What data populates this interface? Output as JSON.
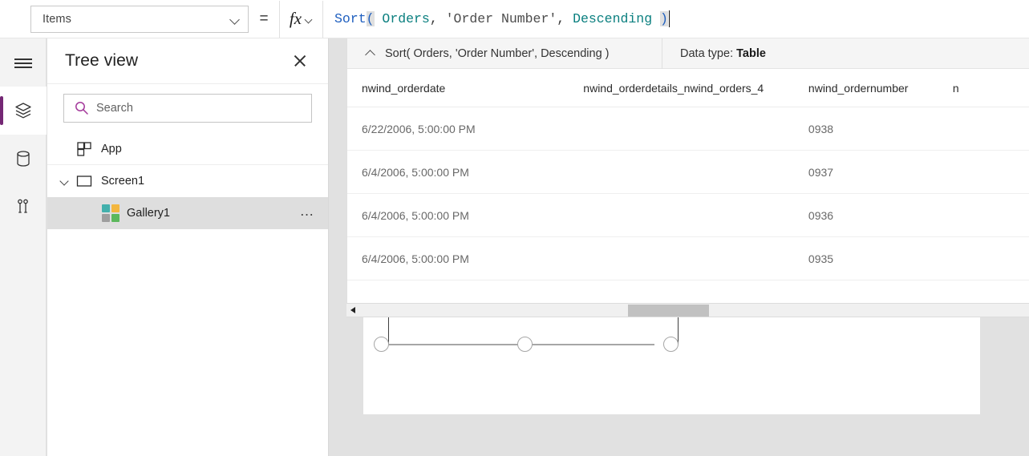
{
  "formula_bar": {
    "property_dropdown": {
      "value": "Items",
      "chevron_icon": "chevron-down-icon"
    },
    "equals_sign": "=",
    "fx_button": {
      "glyph": "fx",
      "chevron_icon": "chevron-down-icon"
    },
    "formula_tokens": [
      {
        "text": "Sort",
        "type": "function"
      },
      {
        "text": "(",
        "type": "paren-highlight"
      },
      {
        "text": " Orders",
        "type": "table"
      },
      {
        "text": ", ",
        "type": "punctuation"
      },
      {
        "text": "'Order Number'",
        "type": "string"
      },
      {
        "text": ", ",
        "type": "punctuation"
      },
      {
        "text": "Descending ",
        "type": "table"
      },
      {
        "text": ")",
        "type": "paren-highlight"
      }
    ],
    "formula_plain": "Sort( Orders, 'Order Number', Descending )"
  },
  "rail": {
    "items": [
      {
        "name": "menu-icon",
        "icon": "hamburger",
        "active": false
      },
      {
        "name": "tree-view-icon",
        "icon": "layers",
        "active": true
      },
      {
        "name": "data-sources-icon",
        "icon": "database",
        "active": false
      },
      {
        "name": "insert-icon",
        "icon": "tools",
        "active": false
      }
    ]
  },
  "tree_view": {
    "title": "Tree view",
    "close_icon": "close-icon",
    "search": {
      "placeholder": "Search",
      "icon": "search-icon",
      "icon_color": "#a4399b"
    },
    "nodes": [
      {
        "label": "App",
        "icon": "app-icon",
        "indent": 0,
        "expandable": false,
        "selected": false,
        "has_overflow": false
      },
      {
        "label": "Screen1",
        "icon": "screen-icon",
        "indent": 0,
        "expandable": true,
        "expanded": true,
        "selected": false,
        "has_overflow": false
      },
      {
        "label": "Gallery1",
        "icon": "gallery-icon",
        "indent": 1,
        "expandable": false,
        "selected": true,
        "has_overflow": true,
        "overflow_label": "…"
      }
    ]
  },
  "results_panel": {
    "collapse_icon": "chevron-up-icon",
    "formula_label": "Sort( Orders, 'Order Number', Descending )",
    "data_type_label": "Data type:",
    "data_type_value": "Table",
    "columns": [
      "nwind_orderdate",
      "nwind_orderdetails_nwind_orders_4",
      "nwind_ordernumber",
      "n"
    ],
    "rows": [
      {
        "nwind_orderdate": "6/22/2006, 5:00:00 PM",
        "nwind_orderdetails_nwind_orders_4": "",
        "nwind_ordernumber": "0938",
        "col4": ""
      },
      {
        "nwind_orderdate": "6/4/2006, 5:00:00 PM",
        "nwind_orderdetails_nwind_orders_4": "",
        "nwind_ordernumber": "0937",
        "col4": ""
      },
      {
        "nwind_orderdate": "6/4/2006, 5:00:00 PM",
        "nwind_orderdetails_nwind_orders_4": "",
        "nwind_ordernumber": "0936",
        "col4": ""
      },
      {
        "nwind_orderdate": "6/4/2006, 5:00:00 PM",
        "nwind_orderdetails_nwind_orders_4": "",
        "nwind_ordernumber": "0935",
        "col4": ""
      }
    ],
    "annotation": {
      "type": "red-rectangle",
      "color": "#fa1414",
      "targets_column": "nwind_ordernumber"
    }
  },
  "horizontal_scrollbar": {
    "left_arrow_icon": "caret-left-icon",
    "thumb_label": "scroll-thumb"
  },
  "canvas": {
    "selected_control": "Gallery1",
    "selection_handles": 3
  },
  "colors": {
    "accent_purple": "#742774",
    "search_icon_purple": "#a4399b",
    "annotation_red": "#fa1414",
    "gallery_icon": [
      "#43b0ac",
      "#f3b63f",
      "#9e9e9e",
      "#5cb85c"
    ]
  }
}
